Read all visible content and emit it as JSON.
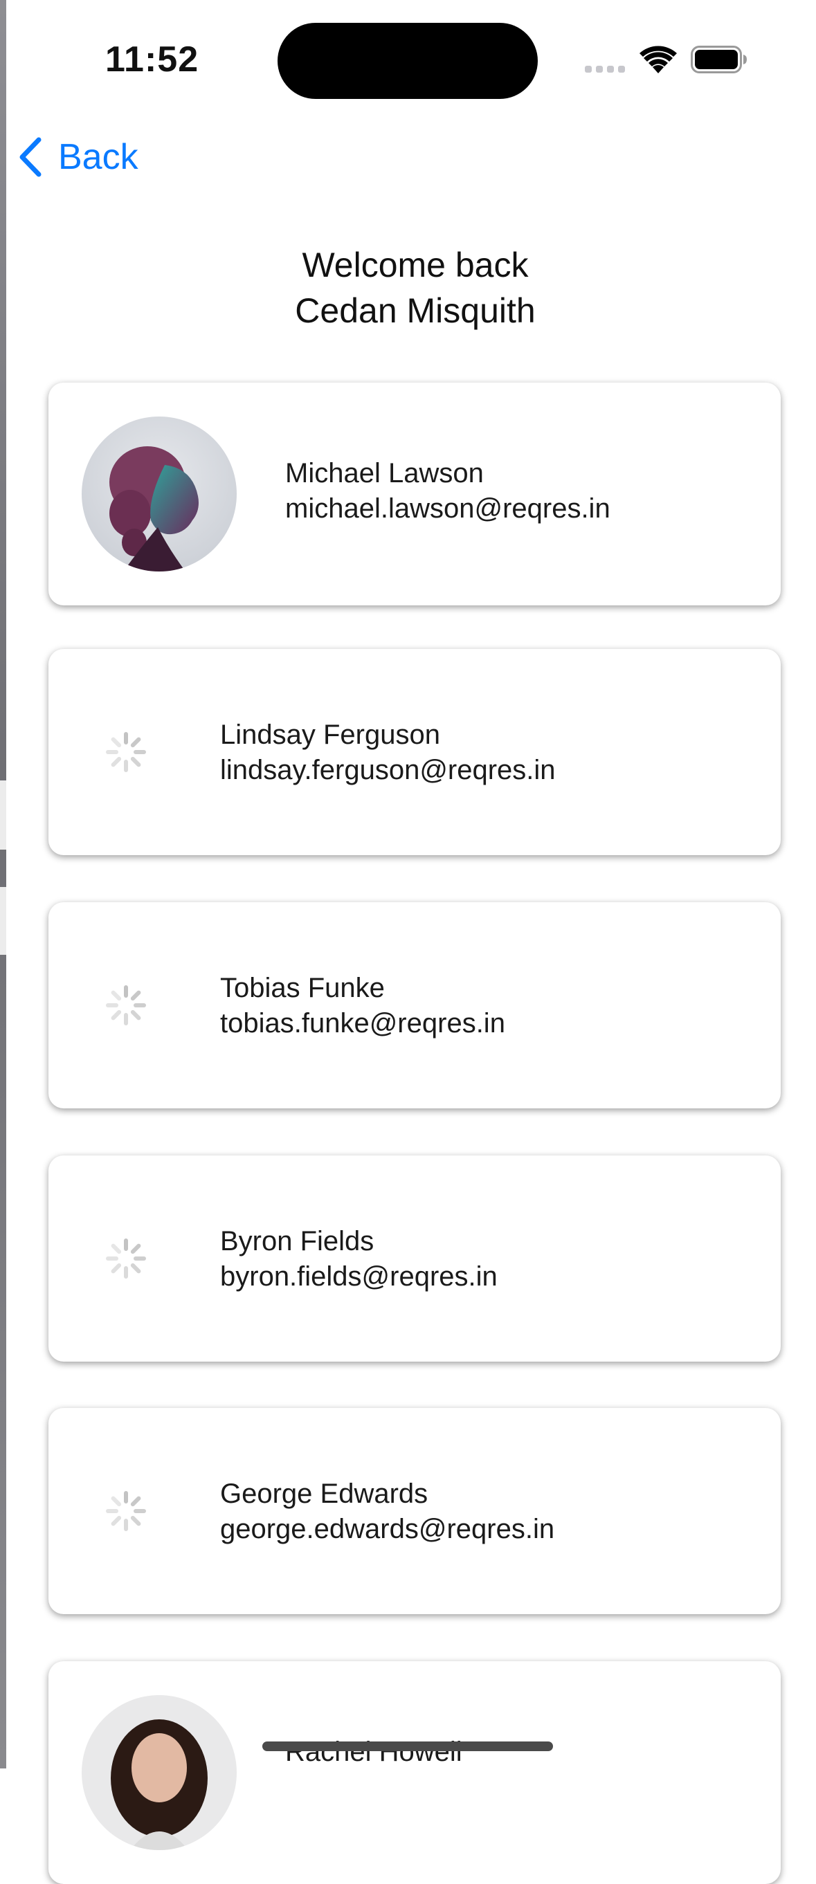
{
  "status_bar": {
    "time": "11:52"
  },
  "nav": {
    "back_label": "Back"
  },
  "header": {
    "line1": "Welcome back",
    "line2": "Cedan Misquith"
  },
  "users": [
    {
      "name": "Michael Lawson",
      "email": "michael.lawson@reqres.in",
      "avatar": "photo"
    },
    {
      "name": "Lindsay Ferguson",
      "email": "lindsay.ferguson@reqres.in",
      "avatar": "loading"
    },
    {
      "name": "Tobias Funke",
      "email": "tobias.funke@reqres.in",
      "avatar": "loading"
    },
    {
      "name": "Byron Fields",
      "email": "byron.fields@reqres.in",
      "avatar": "loading"
    },
    {
      "name": "George Edwards",
      "email": "george.edwards@reqres.in",
      "avatar": "loading"
    },
    {
      "name": "Rachel Howell",
      "email": "",
      "avatar": "photo"
    }
  ],
  "icons": {
    "back": "chevron-left-icon",
    "wifi": "wifi-icon",
    "battery": "battery-icon",
    "signal": "signal-icon",
    "loading": "spinner-icon"
  },
  "colors": {
    "accent": "#0a7aff",
    "card_background": "#ffffff",
    "text": "#1a1a1a"
  }
}
